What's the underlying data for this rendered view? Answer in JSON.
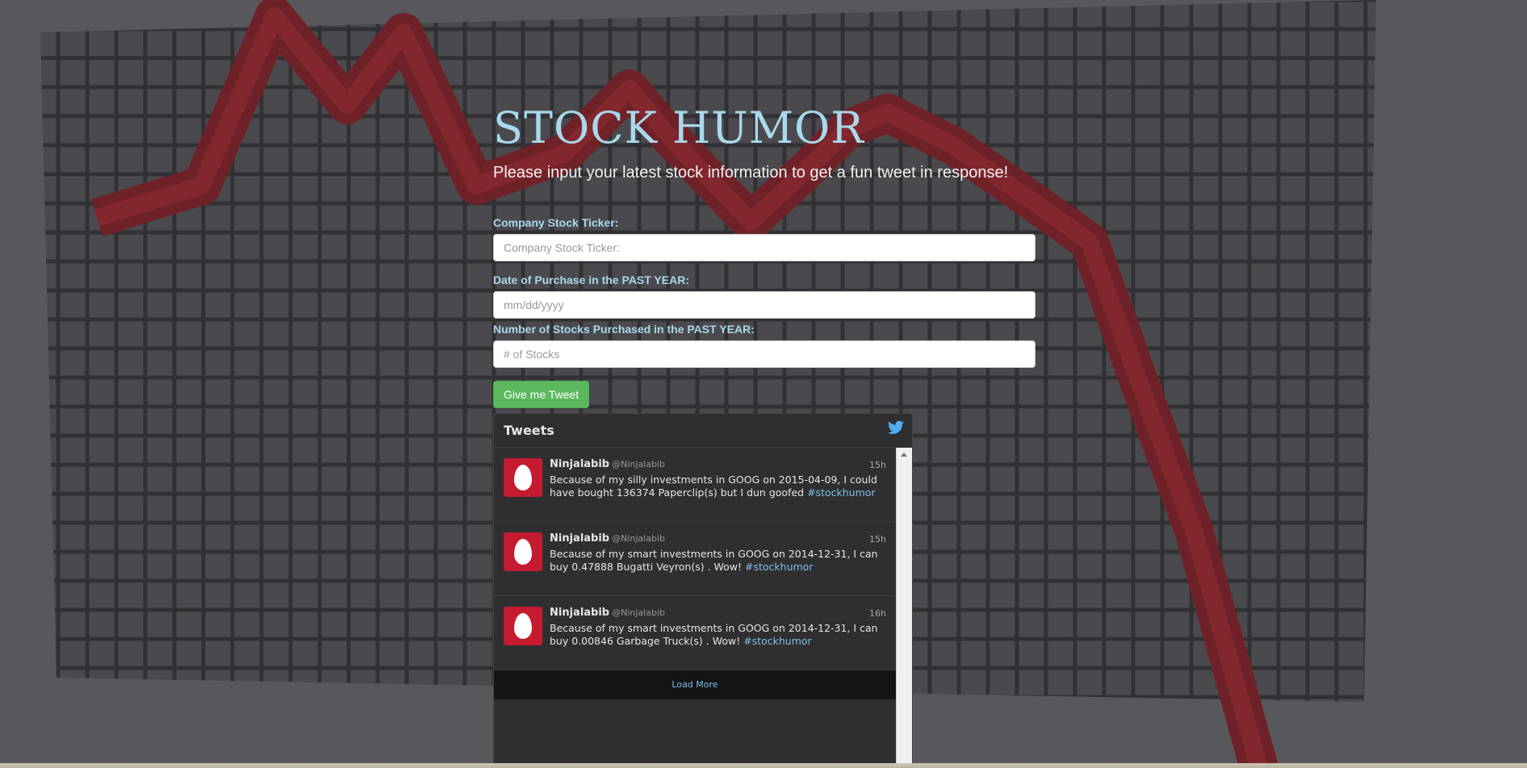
{
  "page": {
    "title": "STOCK HUMOR",
    "subtitle": "Please input your latest stock information to get a fun tweet in response!"
  },
  "form": {
    "ticker_label": "Company Stock Ticker:",
    "ticker_placeholder": "Company Stock Ticker:",
    "date_label": "Date of Purchase in the PAST YEAR:",
    "date_placeholder": "mm/dd/yyyy",
    "count_label": "Number of Stocks Purchased in the PAST YEAR:",
    "count_placeholder": "# of Stocks",
    "submit_label": "Give me Tweet"
  },
  "widget": {
    "title": "Tweets",
    "icon": "twitter-bird-icon",
    "load_more": "Load More",
    "tweets": [
      {
        "name": "Ninjalabib",
        "handle": "@Ninjalabib",
        "time": "15h",
        "text": "Because of my silly investments in GOOG on 2015-04-09, I could have bought 136374 Paperclip(s) but I dun goofed",
        "hashtag": "#stockhumor"
      },
      {
        "name": "Ninjalabib",
        "handle": "@Ninjalabib",
        "time": "15h",
        "text": "Because of my smart investments in GOOG on 2014-12-31, I can buy 0.47888 Bugatti Veyron(s) . Wow!",
        "hashtag": "#stockhumor"
      },
      {
        "name": "Ninjalabib",
        "handle": "@Ninjalabib",
        "time": "16h",
        "text": "Because of my smart investments in GOOG on 2014-12-31, I can buy 0.00846 Garbage Truck(s) . Wow!",
        "hashtag": "#stockhumor"
      }
    ]
  },
  "colors": {
    "title": "#a9d9ec",
    "button": "#5cb85c",
    "avatar": "#c51a2f",
    "link": "#7fbfe9"
  }
}
